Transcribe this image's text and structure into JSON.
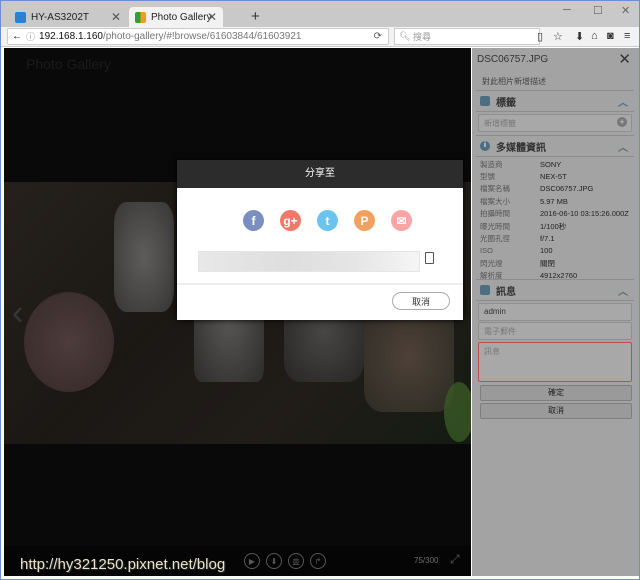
{
  "browser": {
    "tabs": [
      {
        "label": "HY-AS3202T",
        "active": false
      },
      {
        "label": "Photo Gallery",
        "active": true
      }
    ],
    "url_host": "192.168.1.160",
    "url_path": "/photo-gallery/#!browse/61603844/61603921",
    "search_placeholder": "搜尋"
  },
  "viewer": {
    "app_title": "Photo Gallery",
    "counter": "75/300"
  },
  "watermark": "http://hy321250.pixnet.net/blog",
  "share_dialog": {
    "title": "分享至",
    "cancel": "取消",
    "services": [
      {
        "name": "facebook",
        "glyph": "f",
        "color": "#3b5998"
      },
      {
        "name": "google-plus",
        "glyph": "g+",
        "color": "#dd4b39"
      },
      {
        "name": "twitter",
        "glyph": "t",
        "color": "#1da1f2"
      },
      {
        "name": "pixnet",
        "glyph": "P",
        "color": "#f08a2a"
      },
      {
        "name": "email",
        "glyph": "✉",
        "color": "#f58a8a"
      }
    ]
  },
  "sidebar": {
    "filename": "DSC06757.JPG",
    "description_placeholder": "對此相片新增描述",
    "tags": {
      "title": "標籤",
      "placeholder": "新增標籤"
    },
    "media_info": {
      "title": "多媒體資訊",
      "rows": [
        {
          "k": "製造商",
          "v": "SONY"
        },
        {
          "k": "型號",
          "v": "NEX-5T"
        },
        {
          "k": "檔案名稱",
          "v": "DSC06757.JPG"
        },
        {
          "k": "檔案大小",
          "v": "5.97 MB"
        },
        {
          "k": "拍攝時間",
          "v": "2016-06-10 03:15:26.000Z"
        },
        {
          "k": "曝光時間",
          "v": "1/100秒"
        },
        {
          "k": "光圈孔徑",
          "v": "f/7.1"
        },
        {
          "k": "ISO",
          "v": "100"
        },
        {
          "k": "閃光燈",
          "v": "關閉"
        },
        {
          "k": "解析度",
          "v": "4912x2760"
        }
      ]
    },
    "message": {
      "title": "訊息",
      "name_value": "admin",
      "email_placeholder": "電子郵件",
      "message_placeholder": "訊息",
      "confirm": "確定",
      "cancel": "取消"
    }
  }
}
